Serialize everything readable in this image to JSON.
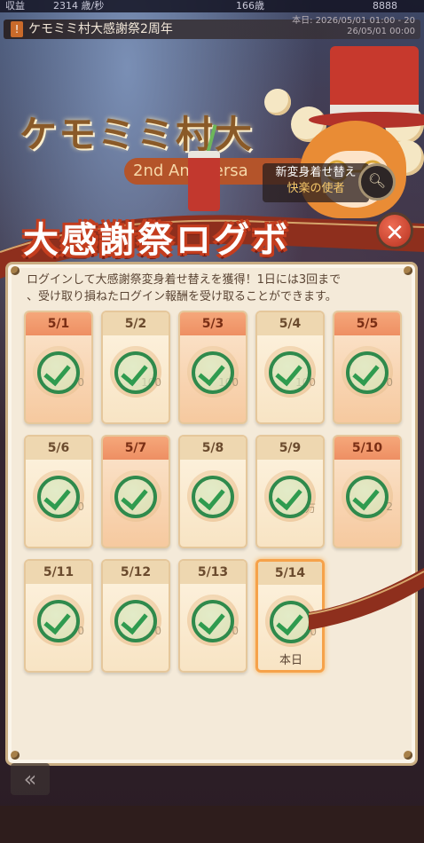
{
  "topbar": {
    "income_label": "収益",
    "income_value": "2314 歳/秒",
    "stat_value": "166歳",
    "gems_value": "8888"
  },
  "news": {
    "icon": "info-icon",
    "text": "ケモミミ村大感謝祭2周年",
    "date_line1": "本日: 2026/05/01 01:00 - 20",
    "date_line2": "26/05/01 00:00"
  },
  "background": {
    "title": "ケモミミ村大",
    "subtitle": "2nd Anniversa"
  },
  "character_bubble": {
    "line1": "新変身着せ替え",
    "line2": "快楽の使者"
  },
  "header": {
    "title": "大感謝祭ログボ",
    "close_icon": "close-icon"
  },
  "description": {
    "line1": "ログインして大感謝祭変身着せ替えを獲得！1日には3回まで",
    "line2": "、受け取り損ねたログイン報酬を受け取ることができます。"
  },
  "days": [
    {
      "date": "5/1",
      "amount": "0",
      "claimed": true,
      "highlight": true
    },
    {
      "date": "5/2",
      "amount": "100",
      "claimed": true,
      "highlight": false
    },
    {
      "date": "5/3",
      "amount": "100",
      "claimed": true,
      "highlight": true
    },
    {
      "date": "5/4",
      "amount": "100",
      "claimed": true,
      "highlight": false
    },
    {
      "date": "5/5",
      "amount": "0",
      "claimed": true,
      "highlight": true
    },
    {
      "date": "5/6",
      "amount": "0",
      "claimed": true,
      "highlight": false
    },
    {
      "date": "5/7",
      "amount": "",
      "claimed": true,
      "highlight": true
    },
    {
      "date": "5/8",
      "amount": "",
      "claimed": true,
      "highlight": false
    },
    {
      "date": "5/9",
      "amount": "万",
      "claimed": true,
      "highlight": false
    },
    {
      "date": "5/10",
      "amount": "2",
      "claimed": true,
      "highlight": true
    },
    {
      "date": "5/11",
      "amount": "0",
      "claimed": true,
      "highlight": false
    },
    {
      "date": "5/12",
      "amount": "0",
      "claimed": true,
      "highlight": false
    },
    {
      "date": "5/13",
      "amount": "0",
      "claimed": true,
      "highlight": false
    },
    {
      "date": "5/14",
      "amount": "0",
      "claimed": true,
      "highlight": false,
      "today": true,
      "today_label": "本日"
    }
  ],
  "colors": {
    "accent_red": "#c43d1e",
    "check_green": "#2f8a4c",
    "panel_bg": "#f4ead9"
  },
  "back_icon": "back-arrow-icon"
}
